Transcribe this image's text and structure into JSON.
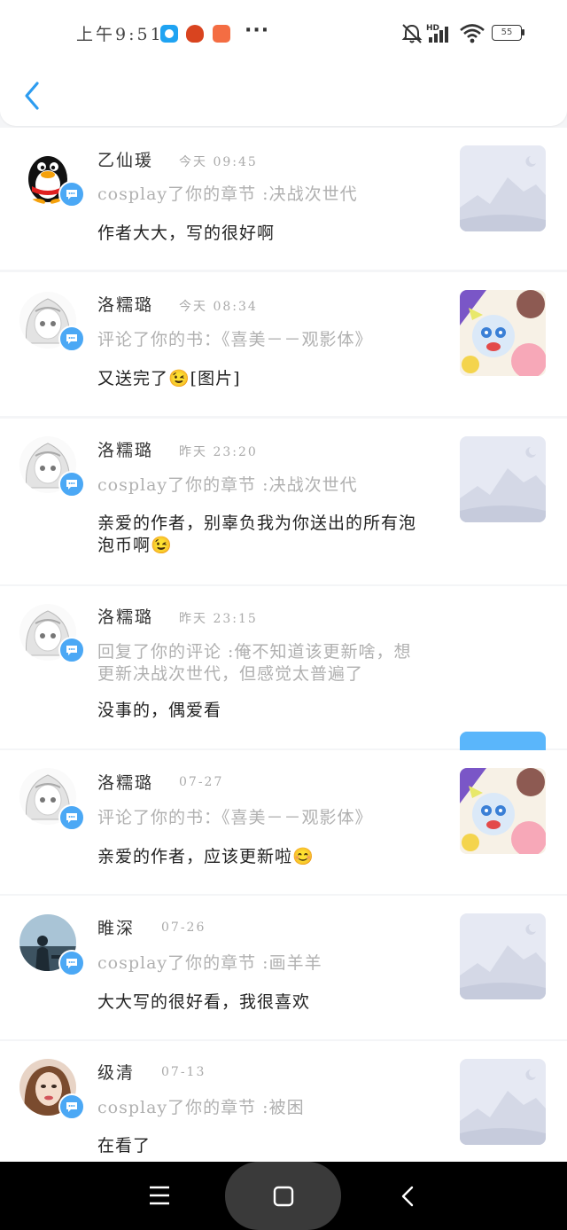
{
  "status_bar": {
    "time": "上午9:51",
    "more": "···",
    "battery": "55"
  },
  "notifications": [
    {
      "user": "乙仙瑗",
      "time": "今天 09:45",
      "action": "cosplay了你的章节 :决战次世代",
      "content": "作者大大，写的很好啊",
      "avatar": "qq-penguin-avatar",
      "thumbnail": "placeholder"
    },
    {
      "user": "洛糯璐",
      "time": "今天 08:34",
      "action": "评论了你的书：《喜美－－观影体》",
      "content": "又送完了😉[图片]",
      "avatar": "anime-girl-avatar",
      "thumbnail": "cartoon"
    },
    {
      "user": "洛糯璐",
      "time": "昨天 23:20",
      "action": "cosplay了你的章节 :决战次世代",
      "content": "亲爱的作者，别辜负我为你送出的所有泡泡币啊😉",
      "avatar": "anime-girl-avatar",
      "thumbnail": "placeholder"
    },
    {
      "user": "洛糯璐",
      "time": "昨天 23:15",
      "action": "回复了你的评论 :俺不知道该更新啥，想更新决战次世代，但感觉太普遍了",
      "content": "没事的，偶爱看",
      "avatar": "anime-girl-avatar",
      "thumbnail": "chat"
    },
    {
      "user": "洛糯璐",
      "time": "07-27",
      "action": "评论了你的书：《喜美－－观影体》",
      "content": "亲爱的作者，应该更新啦😊",
      "avatar": "anime-girl-avatar",
      "thumbnail": "cartoon"
    },
    {
      "user": "睢深",
      "time": "07-26",
      "action": "cosplay了你的章节 :画羊羊",
      "content": "大大写的很好看，我很喜欢",
      "avatar": "silhouette-photo-avatar",
      "thumbnail": "placeholder"
    },
    {
      "user": "级清",
      "time": "07-13",
      "action": "cosplay了你的章节 :被困",
      "content": "在看了",
      "avatar": "woman-photo-avatar",
      "thumbnail": "placeholder"
    }
  ],
  "colors": {
    "accent": "#2d9cf0",
    "badge": "#4ba8f5",
    "chat_tile": "#5ab6fb"
  }
}
